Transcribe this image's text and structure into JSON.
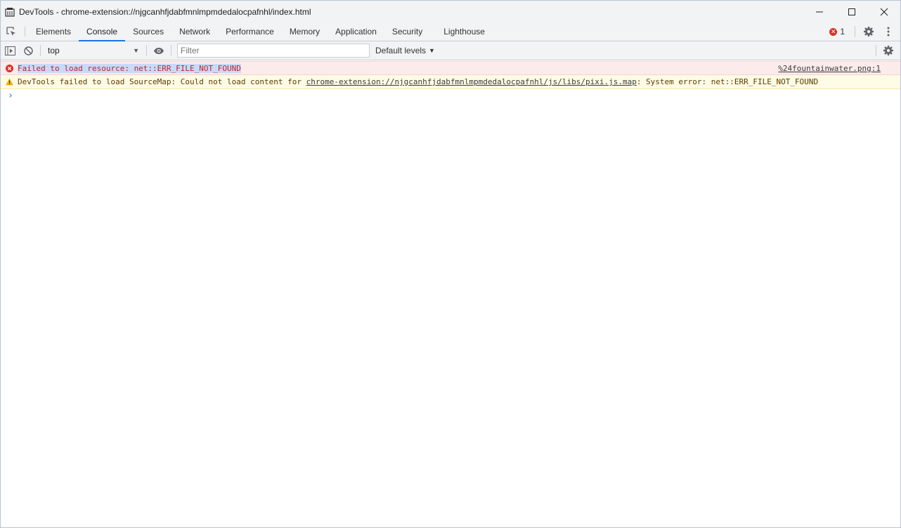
{
  "window": {
    "title": "DevTools - chrome-extension://njgcanhfjdabfmnlmpmdedalocpafnhl/index.html"
  },
  "tabs": [
    {
      "label": "Elements",
      "active": false
    },
    {
      "label": "Console",
      "active": true
    },
    {
      "label": "Sources",
      "active": false
    },
    {
      "label": "Network",
      "active": false
    },
    {
      "label": "Performance",
      "active": false
    },
    {
      "label": "Memory",
      "active": false
    },
    {
      "label": "Application",
      "active": false
    },
    {
      "label": "Security",
      "active": false
    },
    {
      "label": "Lighthouse",
      "active": false
    }
  ],
  "status": {
    "error_count": "1"
  },
  "toolbar": {
    "context": "top",
    "filter_placeholder": "Filter",
    "levels_label": "Default levels"
  },
  "messages": {
    "error": {
      "text": "Failed to load resource: net::ERR_FILE_NOT_FOUND",
      "source": "%24fountainwater.png:1"
    },
    "warning": {
      "prefix": "DevTools failed to load SourceMap: Could not load content for ",
      "link": "chrome-extension://njgcanhfjdabfmnlmpmdedalocpafnhl/js/libs/pixi.js.map",
      "suffix": ": System error: net::ERR_FILE_NOT_FOUND"
    },
    "prompt": "›"
  },
  "colors": {
    "accent": "#1a73e8",
    "error": "#d93025",
    "warning": "#f9ab00"
  }
}
